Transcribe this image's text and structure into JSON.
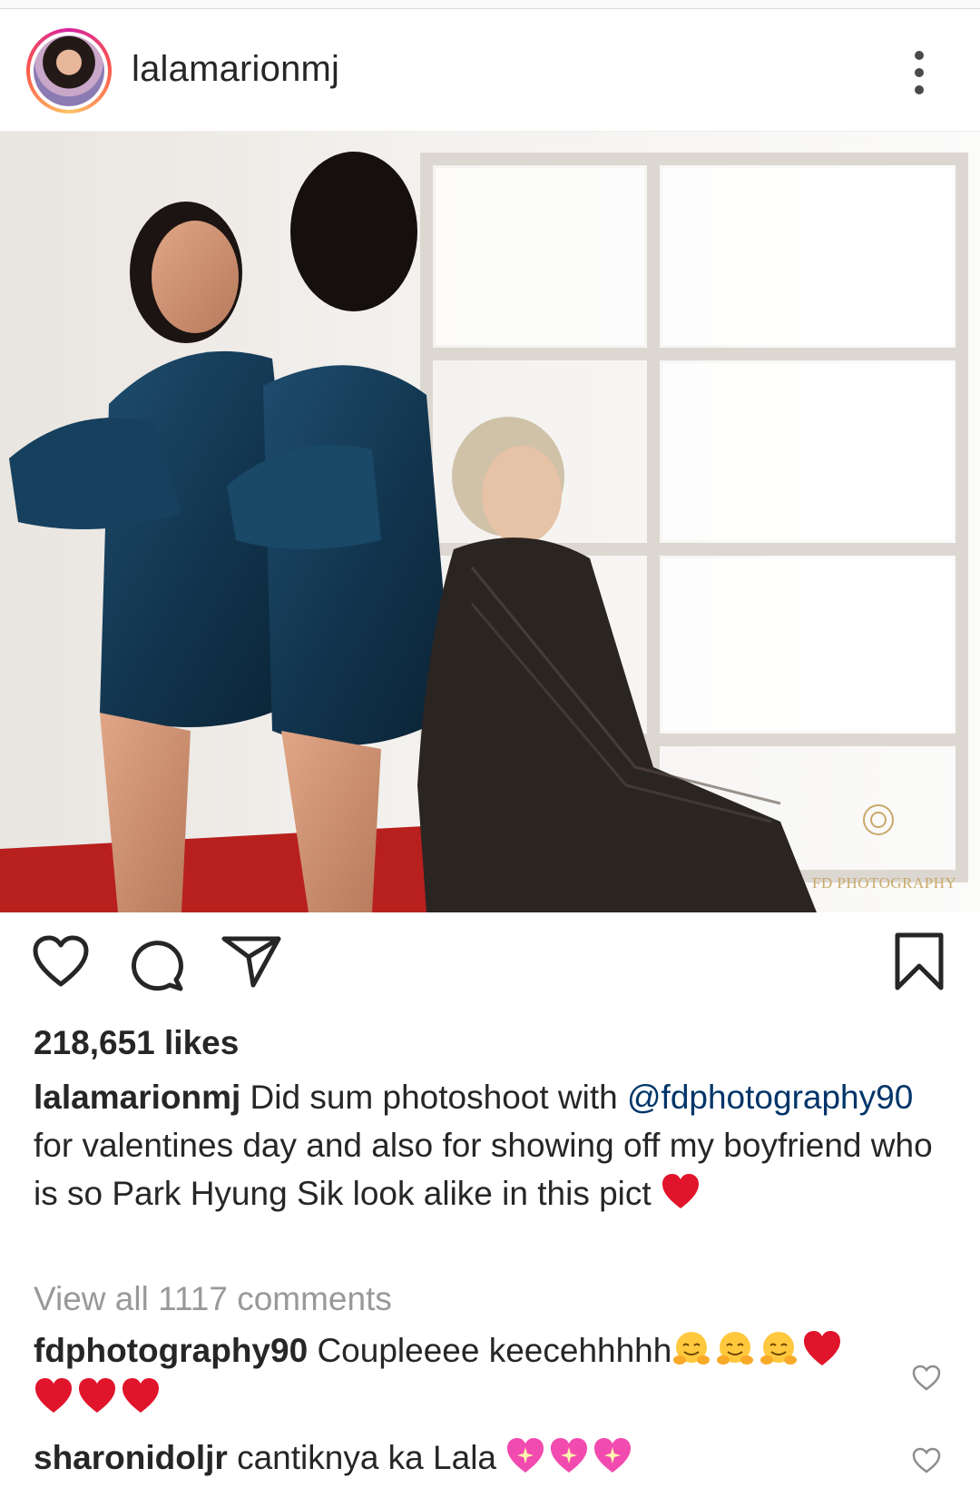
{
  "post": {
    "username": "lalamarionmj",
    "watermark": "FD PHOTOGRAPHY",
    "likes": "218,651 likes",
    "caption": {
      "user": "lalamarionmj",
      "text_1": " Did sum photoshoot with ",
      "mention": "@fdphotography90",
      "text_2": " for valentines day and also for showing off my boyfriend who is so Park Hyung Sik look alike in this pict "
    },
    "view_all_comments": "View all 1117 comments"
  },
  "comments": [
    {
      "user": "fdphotography90",
      "text": " Coupleeee keecehhhhh",
      "emojis": [
        "hugging-face",
        "hugging-face",
        "hugging-face",
        "red-heart",
        "red-heart",
        "red-heart",
        "red-heart"
      ]
    },
    {
      "user": "sharonidoljr",
      "text": " cantiknya ka Lala ",
      "emojis": [
        "sparkling-heart",
        "sparkling-heart",
        "sparkling-heart"
      ]
    }
  ],
  "icons": {
    "like": "heart-outline-icon",
    "comment": "comment-bubble-icon",
    "share": "send-paper-plane-icon",
    "save": "bookmark-icon",
    "more": "more-options-icon",
    "comment_like": "small-heart-icon"
  },
  "colors": {
    "mention": "#003569",
    "muted": "#999999",
    "text": "#262626",
    "heart_emoji": "#e0142a"
  }
}
